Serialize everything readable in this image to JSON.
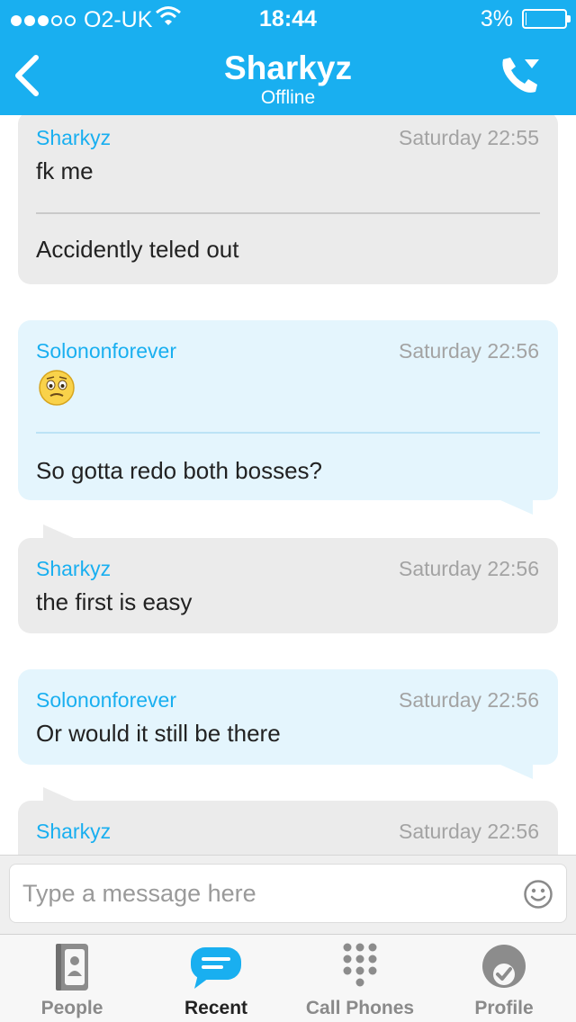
{
  "status_bar": {
    "carrier": "O2-UK",
    "time": "18:44",
    "battery_percent_label": "3%",
    "battery_level": 0.03
  },
  "header": {
    "title": "Sharkyz",
    "subtitle": "Offline",
    "back_icon": "chevron-left-icon",
    "call_icon": "phone-dropdown-icon"
  },
  "messages": [
    {
      "sender": "Sharkyz",
      "time": "Saturday 22:55",
      "lines": [
        "fk me",
        "Accidently teled out"
      ],
      "style": "grey"
    },
    {
      "sender": "Solononforever",
      "time": "Saturday 22:56",
      "emoji": "worried-face-emoji",
      "lines": [
        "So gotta redo both bosses?"
      ],
      "style": "blue"
    },
    {
      "sender": "Sharkyz",
      "time": "Saturday 22:56",
      "lines": [
        "the first is easy"
      ],
      "style": "grey"
    },
    {
      "sender": "Solononforever",
      "time": "Saturday 22:56",
      "lines": [
        "Or would it still be there"
      ],
      "style": "blue"
    },
    {
      "sender": "Sharkyz",
      "time": "Saturday 22:56",
      "lines": [],
      "style": "grey"
    }
  ],
  "composer": {
    "placeholder": "Type a message here",
    "emoji_button_icon": "smiley-icon"
  },
  "tabs": [
    {
      "label": "People",
      "icon": "contacts-book-icon",
      "active": false
    },
    {
      "label": "Recent",
      "icon": "chat-bubble-icon",
      "active": true
    },
    {
      "label": "Call Phones",
      "icon": "dialpad-icon",
      "active": false
    },
    {
      "label": "Profile",
      "icon": "profile-check-icon",
      "active": false
    }
  ],
  "colors": {
    "accent": "#19aff0",
    "incoming_bubble": "#ebebeb",
    "outgoing_bubble": "#e4f5fd",
    "timestamp": "#a3a3a3"
  }
}
